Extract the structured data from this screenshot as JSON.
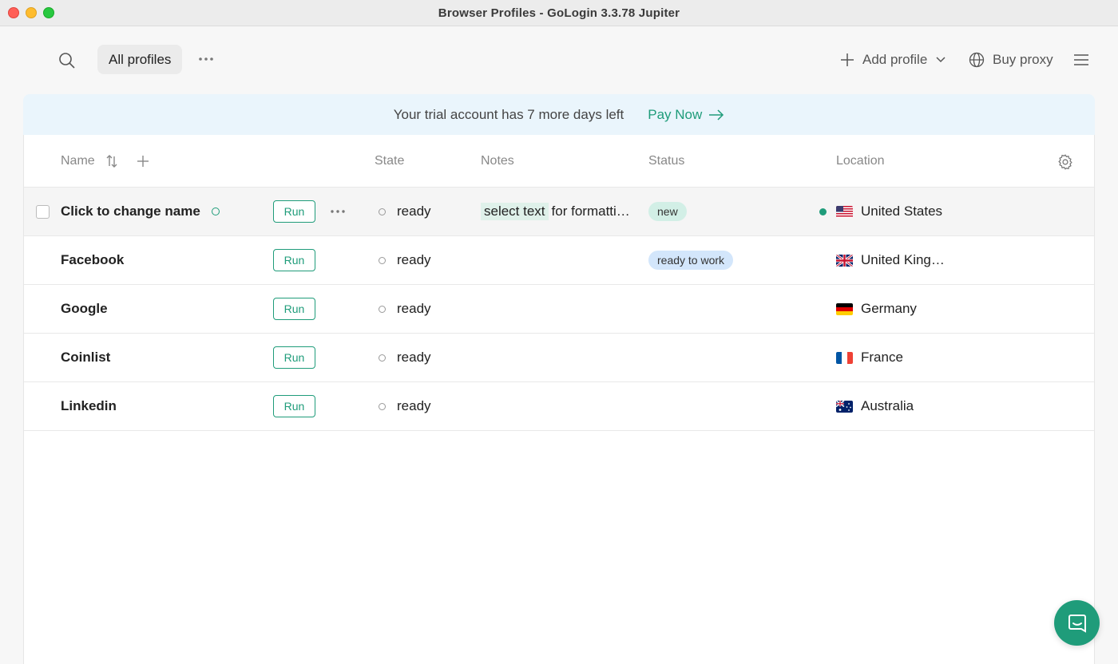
{
  "window": {
    "title": "Browser Profiles - GoLogin 3.3.78 Jupiter"
  },
  "toolbar": {
    "tab_label": "All profiles",
    "add_profile_label": "Add profile",
    "buy_proxy_label": "Buy proxy"
  },
  "banner": {
    "message": "Your trial account has 7 more days left",
    "action_label": "Pay Now"
  },
  "table": {
    "columns": {
      "name": "Name",
      "state": "State",
      "notes": "Notes",
      "status": "Status",
      "location": "Location"
    },
    "rows": [
      {
        "name": "Click to change name",
        "run_label": "Run",
        "state": "ready",
        "notes_highlight": "select text",
        "notes_rest": "for formatti…",
        "status": "new",
        "status_color": "#d2efe6",
        "location": "United States",
        "flag": "us-flag"
      },
      {
        "name": "Facebook",
        "run_label": "Run",
        "state": "ready",
        "status": "ready to work",
        "status_color": "#d3e6fb",
        "location": "United King…",
        "flag": "uk-flag"
      },
      {
        "name": "Google",
        "run_label": "Run",
        "state": "ready",
        "location": "Germany",
        "flag": "de-flag"
      },
      {
        "name": "Coinlist",
        "run_label": "Run",
        "state": "ready",
        "location": "France",
        "flag": "fr-flag"
      },
      {
        "name": "Linkedin",
        "run_label": "Run",
        "state": "ready",
        "location": "Australia",
        "flag": "au-flag"
      }
    ]
  },
  "colors": {
    "accent": "#1f9c7a",
    "banner_bg": "#eaf5fc"
  }
}
